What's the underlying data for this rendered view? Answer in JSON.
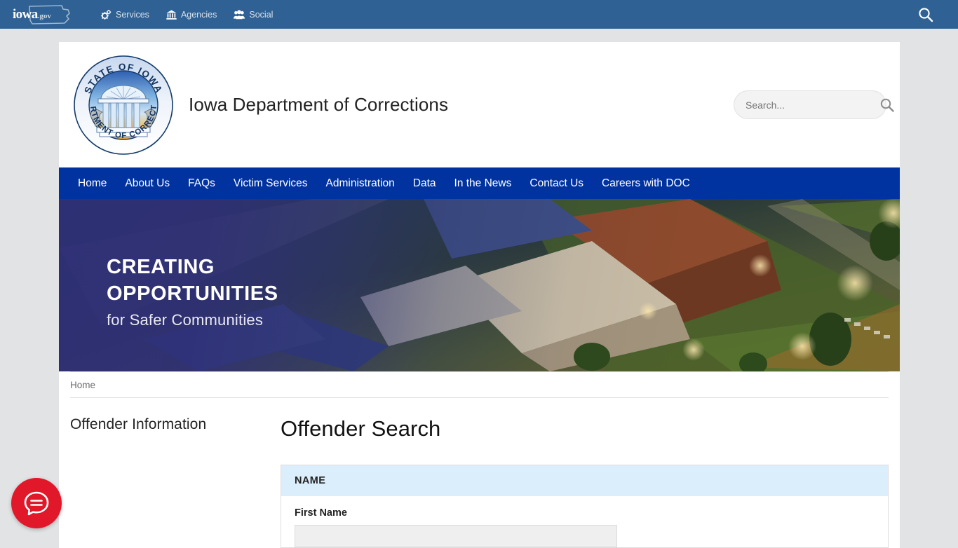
{
  "govbar": {
    "logo_text": "iowa",
    "logo_suffix": ".gov",
    "items": [
      {
        "label": "Services",
        "icon": "gears-icon"
      },
      {
        "label": "Agencies",
        "icon": "bank-icon"
      },
      {
        "label": "Social",
        "icon": "people-icon"
      }
    ],
    "search_icon": "search-icon",
    "background": "#2f6194"
  },
  "header": {
    "site_title": "Iowa Department of Corrections",
    "seal": {
      "top_arc_text": "STATE OF IOWA",
      "bottom_arc_text": "DEPARTMENT OF CORRECTIONS",
      "emblem": "classical-temple-with-columns"
    },
    "search": {
      "placeholder": "Search...",
      "value": "",
      "icon": "magnifier-icon"
    }
  },
  "mainnav": {
    "background": "#0033a0",
    "items": [
      "Home",
      "About Us",
      "FAQs",
      "Victim Services",
      "Administration",
      "Data",
      "In the News",
      "Contact Us",
      "Careers with DOC"
    ]
  },
  "hero": {
    "line1": "CREATING",
    "line2": "OPPORTUNITIES",
    "line3": "for Safer Communities",
    "image_description": "aerial night photograph of correctional facility campus",
    "overlay_color": "#2f2f78"
  },
  "breadcrumb": {
    "items": [
      "Home"
    ]
  },
  "sidebar": {
    "heading": "Offender Information"
  },
  "main": {
    "page_title": "Offender Search",
    "form": {
      "section_label": "NAME",
      "section_bg": "#daeefb",
      "fields": [
        {
          "label": "First Name",
          "value": "",
          "placeholder": ""
        }
      ]
    }
  },
  "chat": {
    "label": "chat-bubble-button",
    "color": "#e1172a"
  }
}
